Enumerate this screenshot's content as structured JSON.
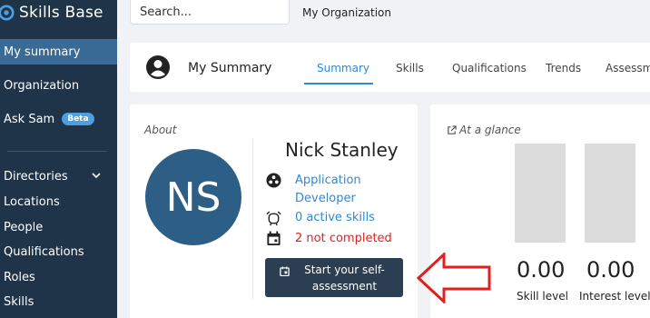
{
  "brand": {
    "name": "Skills Base"
  },
  "sidebar": {
    "items": [
      {
        "label": "My summary"
      },
      {
        "label": "Organization"
      },
      {
        "label": "Ask Sam",
        "badge": "Beta"
      },
      {
        "label": "Directories"
      },
      {
        "label": "Locations"
      },
      {
        "label": "People"
      },
      {
        "label": "Qualifications"
      },
      {
        "label": "Roles"
      },
      {
        "label": "Skills"
      }
    ]
  },
  "search": {
    "placeholder": "Search..."
  },
  "organization": {
    "name": "My Organization"
  },
  "header": {
    "title": "My Summary",
    "tabs": [
      {
        "label": "Summary",
        "active": true
      },
      {
        "label": "Skills"
      },
      {
        "label": "Qualifications"
      },
      {
        "label": "Trends"
      },
      {
        "label": "Assessme"
      }
    ]
  },
  "about": {
    "label": "About",
    "initials": "NS",
    "name": "Nick Stanley",
    "role": "Application Developer",
    "active_skills": "0 active skills",
    "not_completed": "2 not completed",
    "button_label": "Start your self-assessment"
  },
  "glance": {
    "label": "At a glance",
    "skill_level": {
      "value": "0.00",
      "label": "Skill level"
    },
    "interest_level": {
      "value": "0.00",
      "label": "Interest level"
    }
  },
  "colors": {
    "sidebar_bg": "#1f3448",
    "active_nav": "#3a6a96",
    "accent": "#2e8ad6",
    "warning": "#e02020",
    "button_bg": "#2b3e52",
    "annotation_arrow": "#e02020"
  },
  "icons": {
    "brand": "skills-base-logo-icon",
    "user": "user-circle-icon",
    "role": "role-icon",
    "skills": "alarm-icon",
    "calendar": "calendar-icon",
    "external": "external-link-icon"
  }
}
